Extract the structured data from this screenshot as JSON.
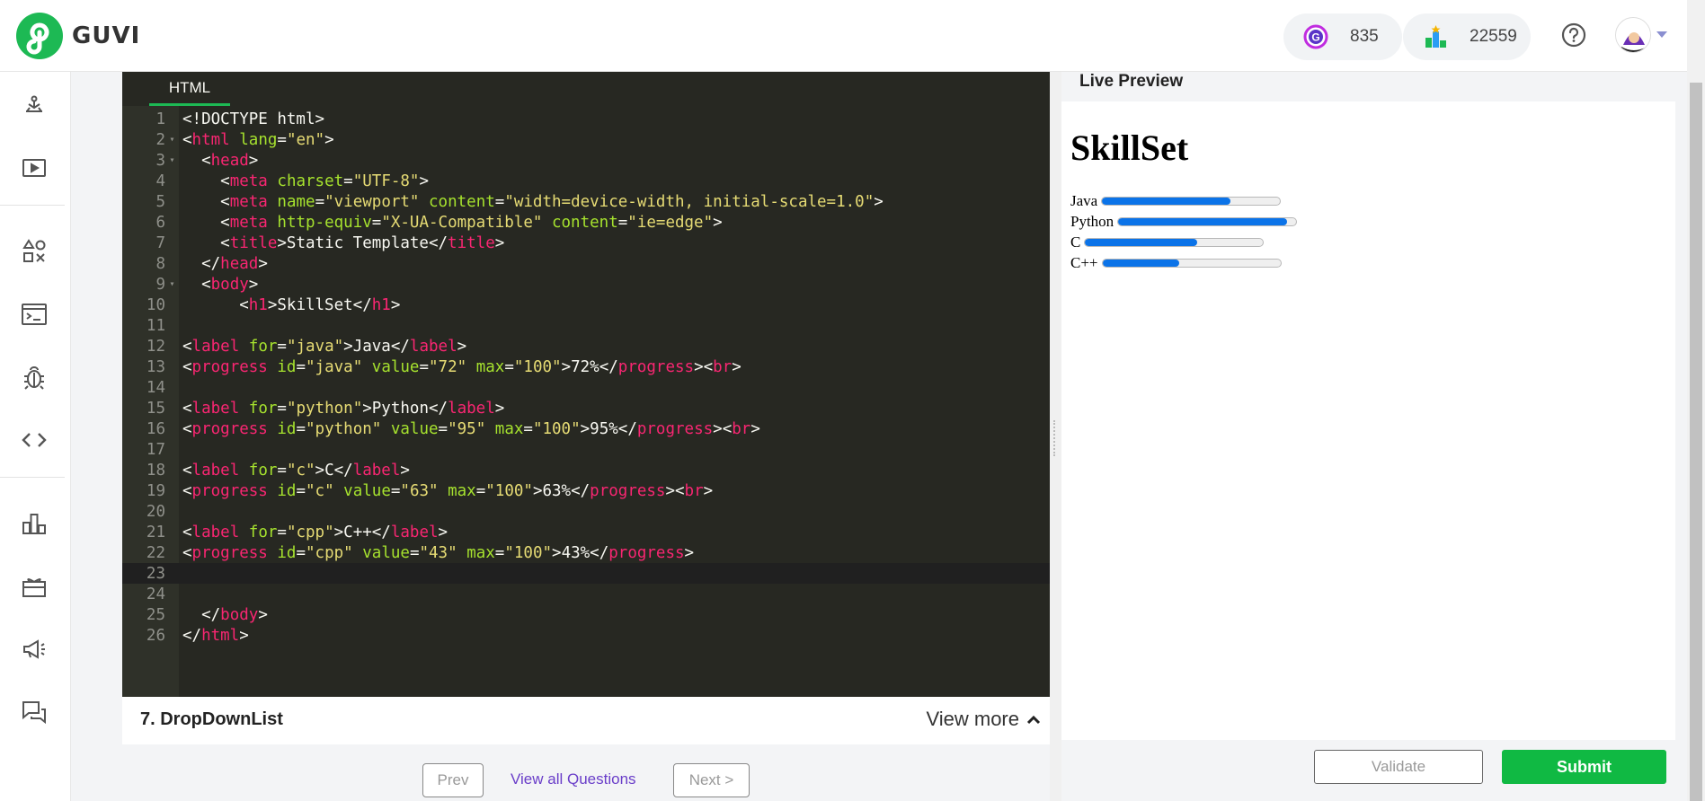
{
  "header": {
    "brand": "GUVI",
    "geekoins": "835",
    "rank": "22559"
  },
  "sidebar": {
    "items": [
      "ide-icon",
      "videos-icon",
      "shapes-icon",
      "terminal-icon",
      "bug-icon",
      "code-icon",
      "leaderboard-icon",
      "gift-icon",
      "announcement-icon",
      "forum-icon"
    ]
  },
  "editor": {
    "tab": "HTML",
    "active_line": 23
  },
  "question": {
    "title": "7. DropDownList",
    "view_more": "View more"
  },
  "navigation": {
    "prev": "Prev",
    "all": "View all Questions",
    "next": "Next >"
  },
  "preview": {
    "label": "Live Preview",
    "heading": "SkillSet",
    "skills": [
      {
        "label": "Java",
        "value": 72
      },
      {
        "label": "Python",
        "value": 95
      },
      {
        "label": "C",
        "value": 63
      },
      {
        "label": "C++",
        "value": 43
      }
    ]
  },
  "actions": {
    "validate": "Validate",
    "submit": "Submit"
  },
  "colors": {
    "brand_green": "#1db954",
    "submit_green": "#10b943",
    "progress_blue": "#0b73e8",
    "editor_bg": "#272822"
  }
}
